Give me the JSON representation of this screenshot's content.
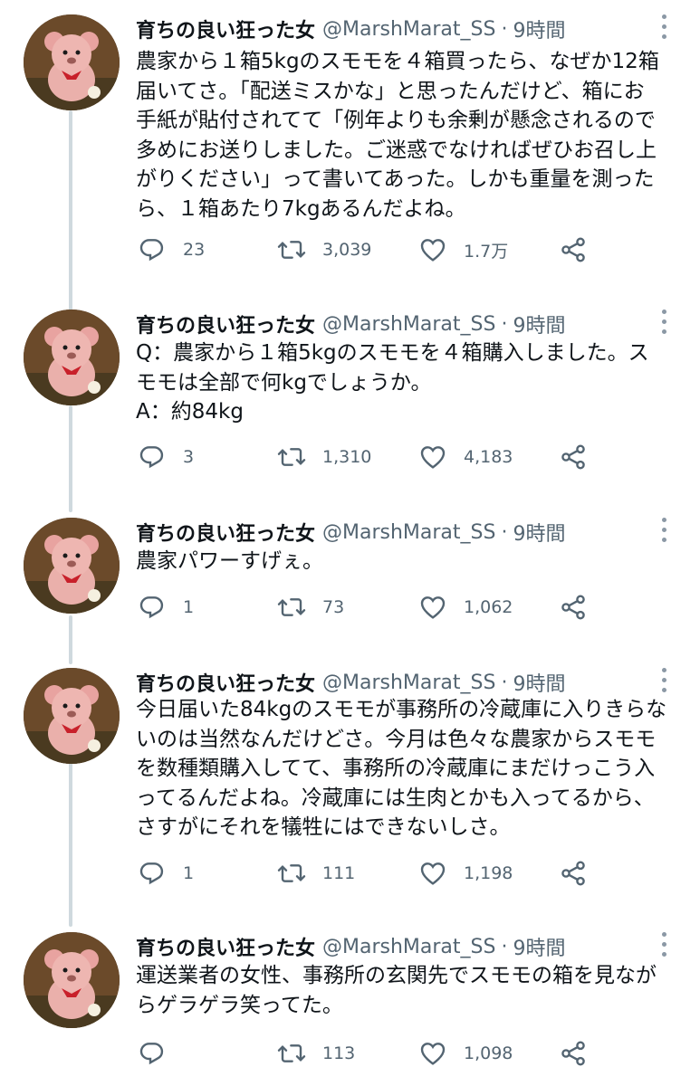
{
  "tweets": [
    {
      "name": "育ちの良い狂った女",
      "handle": "@MarshMarat_SS",
      "dot": "·",
      "time": "9時間",
      "text": "農家から１箱5kgのスモモを４箱買ったら、なぜか12箱\n届いてさ。「配送ミスかな」と思ったんだけど、箱にお\n手紙が貼付されてて「例年よりも余剰が懸念されるので\n多めにお送りしました。ご迷惑でなければぜひお召し上\nがりください」って書いてあった。しかも重量を測った\nら、１箱あたり7kgあるんだよね。",
      "replies": "23",
      "retweets": "3,039",
      "likes": "1.7万"
    },
    {
      "name": "育ちの良い狂った女",
      "handle": "@MarshMarat_SS",
      "dot": "·",
      "time": "9時間",
      "text": "Q：農家から１箱5kgのスモモを４箱購入しました。ス\nモモは全部で何kgでしょうか。\nA：約84kg",
      "replies": "3",
      "retweets": "1,310",
      "likes": "4,183"
    },
    {
      "name": "育ちの良い狂った女",
      "handle": "@MarshMarat_SS",
      "dot": "·",
      "time": "9時間",
      "text": "農家パワーすげぇ。",
      "replies": "1",
      "retweets": "73",
      "likes": "1,062"
    },
    {
      "name": "育ちの良い狂った女",
      "handle": "@MarshMarat_SS",
      "dot": "·",
      "time": "9時間",
      "text": "今日届いた84kgのスモモが事務所の冷蔵庫に入りきらな\nいのは当然なんだけどさ。今月は色々な農家からスモモ\nを数種類購入してて、事務所の冷蔵庫にまだけっこう入\nってるんだよね。冷蔵庫には生肉とかも入ってるから、\nさすがにそれを犠牲にはできないしさ。",
      "replies": "1",
      "retweets": "111",
      "likes": "1,198"
    },
    {
      "name": "育ちの良い狂った女",
      "handle": "@MarshMarat_SS",
      "dot": "·",
      "time": "9時間",
      "text": "運送業者の女性、事務所の玄関先でスモモの箱を見なが\nらゲラゲラ笑ってた。",
      "replies": "",
      "retweets": "113",
      "likes": "1,098"
    }
  ],
  "icons": {
    "reply": "reply-icon",
    "retweet": "retweet-icon",
    "like": "heart-icon",
    "share": "share-icon",
    "more": "more-icon",
    "avatar": "teddy-bear-avatar"
  },
  "colors": {
    "text": "#0f1419",
    "secondary": "#536471",
    "thread_line": "#cfd9de",
    "icon": "#536471"
  }
}
